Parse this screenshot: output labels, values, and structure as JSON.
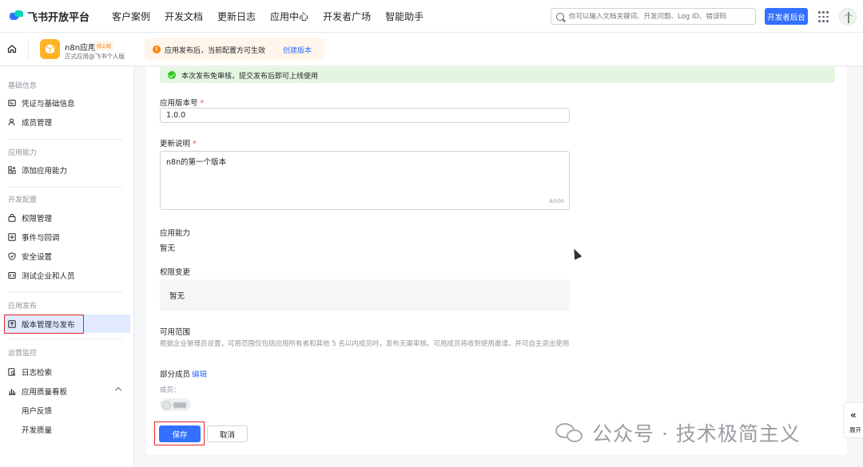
{
  "topnav": {
    "logo_text": "飞书开放平台",
    "links": [
      "客户案例",
      "开发文档",
      "更新日志",
      "应用中心",
      "开发者广场",
      "智能助手"
    ],
    "search_placeholder": "你可以输入文档关键词、开发问题、Log ID、错误码",
    "dev_console_label": "开发者后台"
  },
  "appbar": {
    "app_name": "n8n应用",
    "app_badge": "待上线",
    "app_sub": "正式应用@飞书个人版",
    "notice_text": "应用发布后，当前配置方可生效",
    "notice_link": "创建版本"
  },
  "sidebar": {
    "sections": [
      {
        "title": "基础信息",
        "items": [
          "凭证与基础信息",
          "成员管理"
        ]
      },
      {
        "title": "应用能力",
        "items": [
          "添加应用能力"
        ]
      },
      {
        "title": "开发配置",
        "items": [
          "权限管理",
          "事件与回调",
          "安全设置",
          "测试企业和人员"
        ]
      },
      {
        "title": "应用发布",
        "items": [
          "版本管理与发布"
        ]
      },
      {
        "title": "运营监控",
        "items": [
          "日志检索",
          "应用质量看板"
        ]
      }
    ],
    "sub_items": [
      "用户反馈",
      "开发质量"
    ]
  },
  "form": {
    "success_text": "本次发布免审核，提交发布后即可上线使用",
    "version_label": "应用版本号",
    "version_value": "1.0.0",
    "notes_label": "更新说明",
    "notes_value": "n8n的第一个版本",
    "notes_counter": "9/500",
    "capability_label": "应用能力",
    "capability_value": "暂无",
    "permission_label": "权限变更",
    "permission_value": "暂无",
    "scope_label": "可用范围",
    "scope_hint": "根据企业管理员设置，可用范围仅包括应用所有者和其他 5 名以内成员时，发布无需审核。可用成员将收到使用邀请，并可自主退出使用",
    "partial_members": "部分成员",
    "edit_label": "编辑",
    "members_label": "成员：",
    "save_label": "保存",
    "cancel_label": "取消",
    "required_mark": "*"
  },
  "watermark": "公众号 · 技术极简主义",
  "expand_label": "展开",
  "colors": {
    "accent": "#3370ff",
    "highlight_outline": "#e3242b",
    "success_bg": "#e4f6e0",
    "notice_bg": "#fff5eb"
  }
}
